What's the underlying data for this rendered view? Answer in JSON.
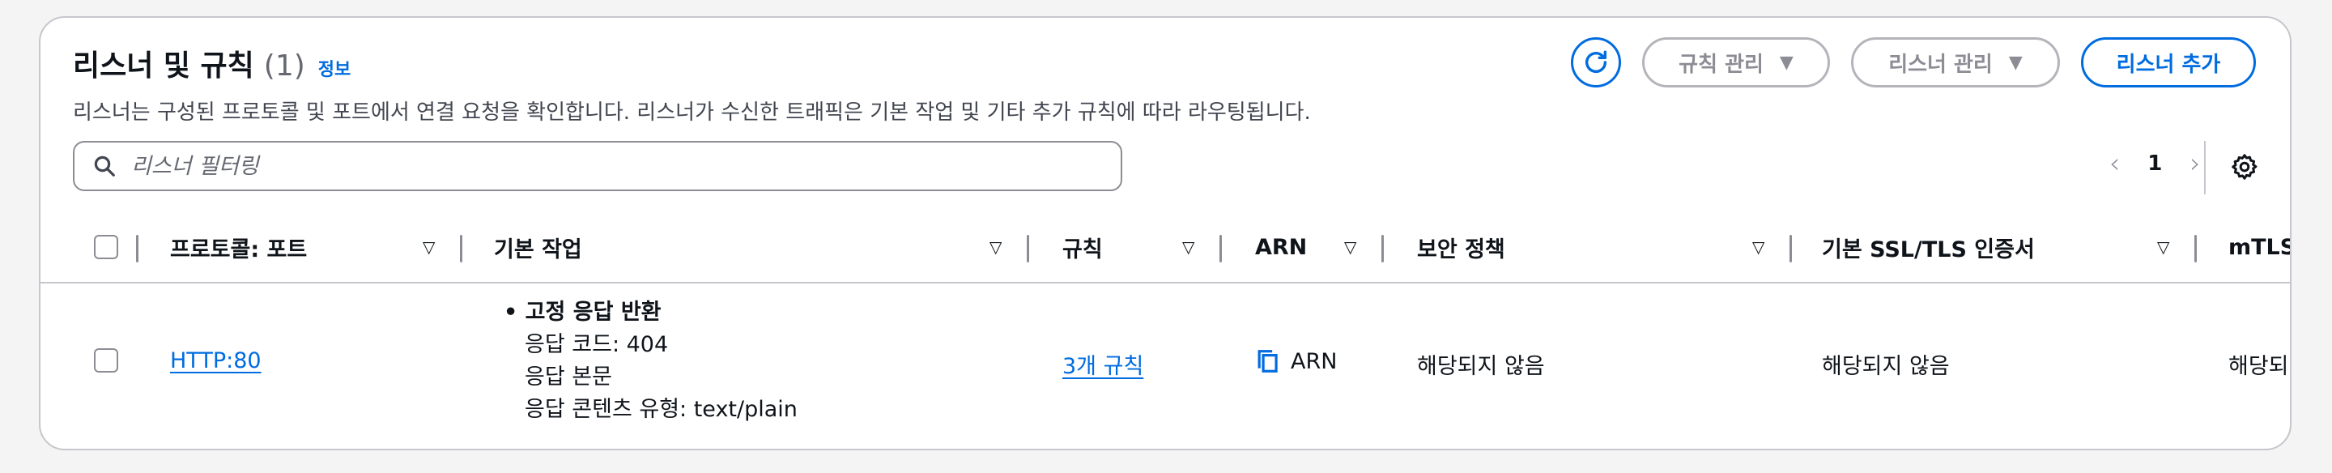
{
  "header": {
    "title": "리스너 및 규칙",
    "count": "(1)",
    "info_link": "정보",
    "description": "리스너는 구성된 프로토콜 및 포트에서 연결 요청을 확인합니다. 리스너가 수신한 트래픽은 기본 작업 및 기타 추가 규칙에 따라 라우팅됩니다."
  },
  "actions": {
    "manage_rules": "규칙 관리",
    "manage_listener": "리스너 관리",
    "add_listener": "리스너 추가"
  },
  "search": {
    "placeholder": "리스너 필터링"
  },
  "pagination": {
    "current_page": "1"
  },
  "columns": {
    "protocol_port": "프로토콜: 포트",
    "default_action": "기본 작업",
    "rules": "규칙",
    "arn": "ARN",
    "security_policy": "보안 정책",
    "default_cert": "기본 SSL/TLS 인증서",
    "mtls": "mTLS"
  },
  "rows": [
    {
      "protocol_port": "HTTP:80",
      "action_title": "고정 응답 반환",
      "action_code": "응답 코드: 404",
      "action_body": "응답 본문",
      "action_content_type": "응답 콘텐츠 유형: text/plain",
      "rules": "3개 규칙",
      "arn": "ARN",
      "security_policy": "해당되지 않음",
      "default_cert": "해당되지 않음",
      "mtls": "해당되지"
    }
  ],
  "colors": {
    "accent": "#006ce0",
    "border": "#c6c6cd",
    "text": "#0f141a",
    "muted": "#656871"
  }
}
